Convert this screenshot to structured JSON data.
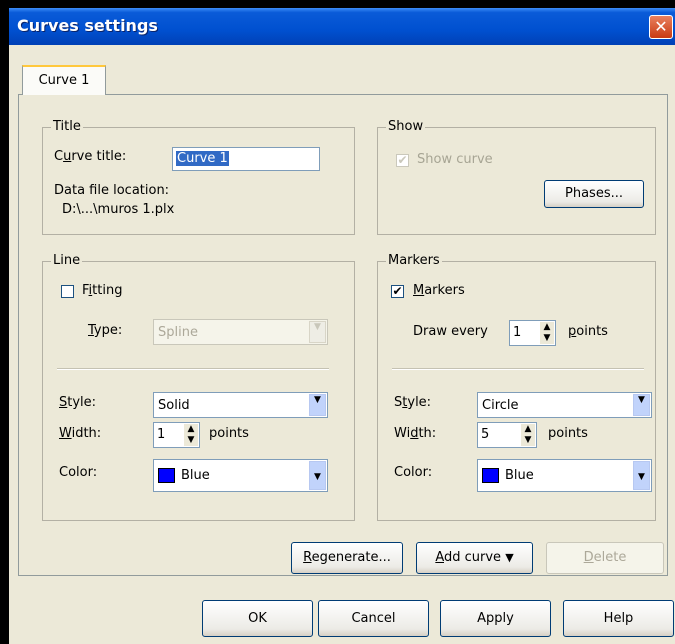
{
  "window": {
    "title": "Curves settings",
    "close_glyph": "✕"
  },
  "tabs": [
    {
      "label": "Curve 1"
    }
  ],
  "title_group": {
    "legend": "Title",
    "curve_title_label": "Curve title:",
    "curve_title_value": "Curve 1",
    "data_file_label": "Data file location:",
    "data_file_value": "D:\\...\\muros 1.plx"
  },
  "show_group": {
    "legend": "Show",
    "show_curve_label": "Show curve",
    "show_curve_checked": true,
    "phases_button": "Phases..."
  },
  "line_group": {
    "legend": "Line",
    "fitting_label": "Fitting",
    "fitting_checked": false,
    "type_label": "Type:",
    "type_value": "Spline",
    "style_label": "Style:",
    "style_value": "Solid",
    "width_label": "Width:",
    "width_value": "1",
    "width_unit": "points",
    "color_label": "Color:",
    "color_value": "Blue",
    "color_hex": "#0000ff"
  },
  "markers_group": {
    "legend": "Markers",
    "markers_label": "Markers",
    "markers_checked": true,
    "draw_every_label": "Draw every",
    "draw_every_value": "1",
    "draw_every_unit": "points",
    "style_label": "Style:",
    "style_value": "Circle",
    "width_label": "Width:",
    "width_value": "5",
    "width_unit": "points",
    "color_label": "Color:",
    "color_value": "Blue",
    "color_hex": "#0000ff"
  },
  "actions": {
    "regenerate": "Regenerate...",
    "add_curve": "Add curve",
    "delete": "Delete"
  },
  "footer": {
    "ok": "OK",
    "cancel": "Cancel",
    "apply": "Apply",
    "help": "Help"
  }
}
